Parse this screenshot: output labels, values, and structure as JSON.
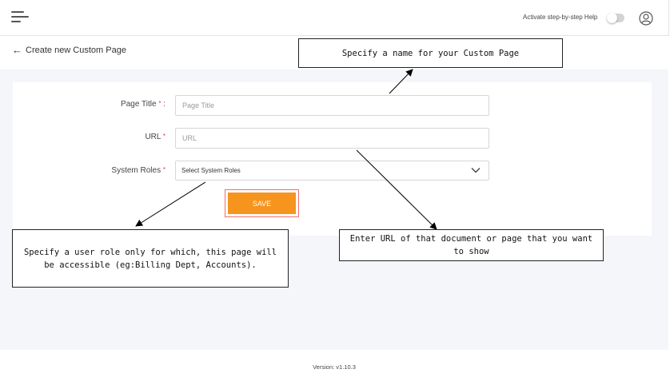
{
  "header": {
    "help_toggle_label": "Activate step-by-step Help",
    "help_toggle_on": false
  },
  "page": {
    "back_label": "Create new Custom Page"
  },
  "form": {
    "title_label": "Page Title",
    "title_colon": ":",
    "title_placeholder": "Page Title",
    "url_label": "URL",
    "url_placeholder": "URL",
    "roles_label": "System Roles",
    "roles_value": "Select System Roles",
    "required_mark": "*",
    "save_label": "SAVE"
  },
  "callouts": {
    "name": "Specify a name for your Custom Page",
    "url": "Enter URL of that document or page that you want to show",
    "roles": "Specify a user role only for which, this page will be accessible (eg:Billing Dept, Accounts)."
  },
  "footer": {
    "version": "Version: v1.10.3"
  },
  "colors": {
    "accent": "#f7941d",
    "highlight": "#f06e6e",
    "background": "#f5f6fa",
    "required": "#e53935"
  }
}
